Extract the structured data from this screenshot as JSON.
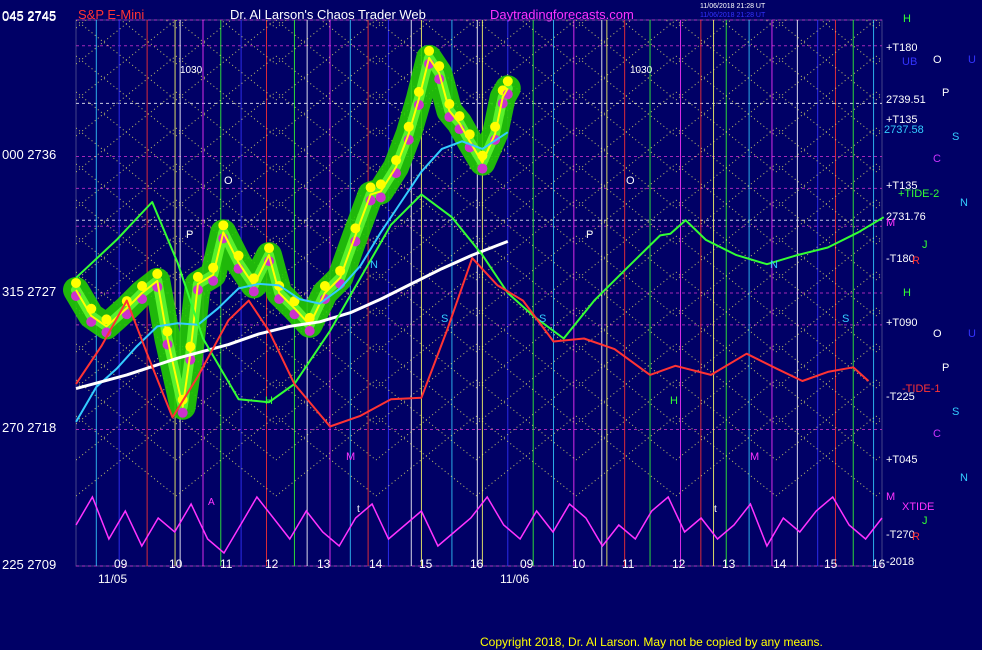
{
  "header": {
    "instrument": "S&P E-Mini",
    "title": "Dr. Al Larson's Chaos Trader Web",
    "site": "Daytradingforecasts.com",
    "timestamp_1": "11/06/2018 21:28 UT",
    "timestamp_2": "11/06/2018 21:28 UT",
    "software": "",
    "top_left_price": "045 2745"
  },
  "footer": {
    "copyright": "Copyright 2018, Dr. Al Larson. May not be copied by any means."
  },
  "axis": {
    "left_labels": [
      {
        "text": "045  2745",
        "value": 2745
      },
      {
        "text": "000  2736",
        "value": 2736
      },
      {
        "text": "315  2727",
        "value": 2727
      },
      {
        "text": "270  2718",
        "value": 2718
      },
      {
        "text": "225  2709",
        "value": 2709
      }
    ],
    "hours": [
      "09",
      "10",
      "11",
      "12",
      "13",
      "14",
      "15",
      "16",
      "09",
      "10",
      "11",
      "12",
      "13",
      "14",
      "15",
      "16"
    ],
    "dates": [
      "11/05",
      "11/06"
    ],
    "ylim": [
      2709,
      2745
    ]
  },
  "right_labels": [
    {
      "text": "+T180",
      "color": "#ffffff"
    },
    {
      "text": "UB",
      "color": "#3333ff"
    },
    {
      "text": "O",
      "color": "#ffffff"
    },
    {
      "text": "U",
      "color": "#3333ff"
    },
    {
      "text": "2739.51",
      "color": "#ffffff"
    },
    {
      "text": "P",
      "color": "#ffffff"
    },
    {
      "text": "+T135",
      "color": "#ffffff"
    },
    {
      "text": "2737.58",
      "color": "#33ccff"
    },
    {
      "text": "S",
      "color": "#33ccff"
    },
    {
      "text": "C",
      "color": "#cc33ff"
    },
    {
      "text": "+T135",
      "color": "#ffffff"
    },
    {
      "text": "+TIDE-2",
      "color": "#33ff33"
    },
    {
      "text": "N",
      "color": "#33ccff"
    },
    {
      "text": "2731.76",
      "color": "#ffffff"
    },
    {
      "text": "M",
      "color": "#ff33ff"
    },
    {
      "text": "J",
      "color": "#33ff33"
    },
    {
      "text": "-T180",
      "color": "#ffffff"
    },
    {
      "text": "R",
      "color": "#ff3333"
    },
    {
      "text": "H",
      "color": "#33ff33"
    },
    {
      "text": "+T090",
      "color": "#ffffff"
    },
    {
      "text": "O",
      "color": "#ffffff"
    },
    {
      "text": "U",
      "color": "#3333ff"
    },
    {
      "text": "P",
      "color": "#ffffff"
    },
    {
      "text": "-TIDE-1",
      "color": "#ff3333"
    },
    {
      "text": "-T225",
      "color": "#ffffff"
    },
    {
      "text": "S",
      "color": "#33ccff"
    },
    {
      "text": "C",
      "color": "#cc33ff"
    },
    {
      "text": "+T045",
      "color": "#ffffff"
    },
    {
      "text": "N",
      "color": "#33ccff"
    },
    {
      "text": "M",
      "color": "#ff33ff"
    },
    {
      "text": "XTIDE",
      "color": "#ff33ff"
    },
    {
      "text": "J",
      "color": "#33ff33"
    },
    {
      "text": "-T270",
      "color": "#ffffff"
    },
    {
      "text": "R",
      "color": "#ff3333"
    },
    {
      "text": "-2018",
      "color": "#ffffff"
    },
    {
      "text": "H",
      "color": "#33ff33"
    }
  ],
  "chart_labels": [
    {
      "text": "1030",
      "color": "#ffffff"
    },
    {
      "text": "O",
      "color": "#ffffff"
    },
    {
      "text": "P",
      "color": "#ffffff"
    },
    {
      "text": "H",
      "color": "#33ff33"
    },
    {
      "text": "N",
      "color": "#33ccff"
    },
    {
      "text": "S",
      "color": "#33ccff"
    },
    {
      "text": "M",
      "color": "#ff33ff"
    },
    {
      "text": "t",
      "color": "#ffffff"
    },
    {
      "text": "1030",
      "color": "#ffffff"
    },
    {
      "text": "O",
      "color": "#ffffff"
    },
    {
      "text": "P",
      "color": "#ffffff"
    },
    {
      "text": "S",
      "color": "#33ccff"
    },
    {
      "text": "H",
      "color": "#33ff33"
    },
    {
      "text": "N",
      "color": "#33ccff"
    },
    {
      "text": "S",
      "color": "#33ccff"
    },
    {
      "text": "M",
      "color": "#ff33ff"
    },
    {
      "text": "t",
      "color": "#ffffff"
    },
    {
      "text": "A",
      "color": "#ff33ff"
    }
  ],
  "chart_data": {
    "type": "line",
    "title": "S&P E-Mini",
    "ylim": [
      2709,
      2745
    ],
    "x_unit": "trading hour index (0 = 11/05 09:00)",
    "series": [
      {
        "name": "",
        "color": "#ffff00",
        "points": [
          [
            0,
            2727.2
          ],
          [
            0.3,
            2725.5
          ],
          [
            0.6,
            2724.8
          ],
          [
            1.0,
            2726.0
          ],
          [
            1.3,
            2727.0
          ],
          [
            1.6,
            2727.8
          ],
          [
            1.8,
            2724.0
          ],
          [
            2.1,
            2719.5
          ],
          [
            2.25,
            2723.0
          ],
          [
            2.4,
            2727.6
          ],
          [
            2.7,
            2728.2
          ],
          [
            2.9,
            2731.0
          ],
          [
            3.2,
            2729.0
          ],
          [
            3.5,
            2727.5
          ],
          [
            3.8,
            2729.5
          ],
          [
            4.0,
            2727.0
          ],
          [
            4.3,
            2726.0
          ],
          [
            4.6,
            2724.9
          ],
          [
            4.9,
            2727.0
          ],
          [
            5.2,
            2728.0
          ],
          [
            5.5,
            2730.8
          ],
          [
            5.8,
            2733.5
          ],
          [
            6.0,
            2733.7
          ],
          [
            6.3,
            2735.3
          ],
          [
            6.55,
            2737.5
          ],
          [
            6.75,
            2739.8
          ],
          [
            6.95,
            2742.5
          ],
          [
            7.15,
            2741.5
          ],
          [
            7.35,
            2739.0
          ],
          [
            7.55,
            2738.2
          ],
          [
            7.75,
            2737.0
          ],
          [
            8.0,
            2735.6
          ],
          [
            8.25,
            2737.5
          ],
          [
            8.4,
            2739.9
          ],
          [
            8.5,
            2740.5
          ]
        ]
      },
      {
        "name": "",
        "color": "#33ccff",
        "points": [
          [
            0,
            2718.5
          ],
          [
            0.4,
            2720.8
          ],
          [
            0.8,
            2722.0
          ],
          [
            1.2,
            2723.5
          ],
          [
            1.6,
            2724.8
          ],
          [
            2.0,
            2725.0
          ],
          [
            2.4,
            2724.9
          ],
          [
            2.8,
            2726.0
          ],
          [
            3.2,
            2727.3
          ],
          [
            3.6,
            2727.6
          ],
          [
            4.0,
            2727.5
          ],
          [
            4.4,
            2726.6
          ],
          [
            4.8,
            2726.3
          ],
          [
            5.2,
            2727.3
          ],
          [
            5.6,
            2728.8
          ],
          [
            6.0,
            2731.0
          ],
          [
            6.4,
            2733.0
          ],
          [
            6.8,
            2735.0
          ],
          [
            7.2,
            2736.5
          ],
          [
            7.6,
            2737.0
          ],
          [
            8.0,
            2736.5
          ],
          [
            8.5,
            2737.6
          ]
        ]
      },
      {
        "name": "",
        "color": "#ffffff",
        "points": [
          [
            0,
            2720.7
          ],
          [
            1.0,
            2721.6
          ],
          [
            2.0,
            2722.7
          ],
          [
            3.0,
            2723.6
          ],
          [
            3.6,
            2724.3
          ],
          [
            4.2,
            2724.8
          ],
          [
            4.8,
            2725.1
          ],
          [
            5.4,
            2725.7
          ],
          [
            6.0,
            2726.6
          ],
          [
            6.6,
            2727.6
          ],
          [
            7.2,
            2728.6
          ],
          [
            7.8,
            2729.5
          ],
          [
            8.5,
            2730.4
          ]
        ]
      },
      {
        "name": "",
        "color": "#33ff33",
        "points": [
          [
            0,
            2728
          ],
          [
            0.8,
            2730.5
          ],
          [
            1.5,
            2733.0
          ],
          [
            2.0,
            2729.0
          ],
          [
            2.5,
            2724.0
          ],
          [
            3.2,
            2720.0
          ],
          [
            3.8,
            2719.8
          ],
          [
            4.3,
            2721.0
          ],
          [
            5.0,
            2724.5
          ],
          [
            5.6,
            2728.0
          ],
          [
            6.2,
            2731.5
          ],
          [
            6.8,
            2733.5
          ],
          [
            7.4,
            2732.0
          ],
          [
            8.0,
            2729.5
          ],
          [
            8.5,
            2727.0
          ],
          [
            9.0,
            2725.5
          ],
          [
            9.6,
            2724.0
          ],
          [
            10.2,
            2726.5
          ],
          [
            10.8,
            2728.5
          ],
          [
            11.5,
            2730.8
          ],
          [
            11.7,
            2730.9
          ],
          [
            12.0,
            2731.8
          ],
          [
            12.4,
            2730.5
          ],
          [
            13.0,
            2729.5
          ],
          [
            13.6,
            2728.9
          ],
          [
            14.2,
            2729.5
          ],
          [
            14.8,
            2730.0
          ],
          [
            15.4,
            2731.0
          ],
          [
            15.9,
            2732.0
          ]
        ]
      },
      {
        "name": "",
        "color": "#ff3333",
        "points": [
          [
            0,
            2721.0
          ],
          [
            0.5,
            2723.5
          ],
          [
            1.0,
            2726.5
          ],
          [
            1.4,
            2723.0
          ],
          [
            1.9,
            2718.8
          ],
          [
            2.4,
            2721.5
          ],
          [
            3.0,
            2725.2
          ],
          [
            3.4,
            2726.5
          ],
          [
            3.8,
            2724.5
          ],
          [
            4.3,
            2721.0
          ],
          [
            5.0,
            2718.2
          ],
          [
            5.6,
            2718.9
          ],
          [
            6.2,
            2720.0
          ],
          [
            6.8,
            2720.1
          ],
          [
            7.3,
            2724.5
          ],
          [
            7.8,
            2729.3
          ],
          [
            8.3,
            2727.5
          ],
          [
            8.8,
            2726.5
          ],
          [
            9.4,
            2723.8
          ],
          [
            10.0,
            2724.0
          ],
          [
            10.6,
            2723.3
          ],
          [
            11.3,
            2721.6
          ],
          [
            11.8,
            2722.2
          ],
          [
            12.5,
            2721.6
          ],
          [
            13.2,
            2723.0
          ],
          [
            13.8,
            2722.0
          ],
          [
            14.3,
            2721.2
          ],
          [
            14.8,
            2721.8
          ],
          [
            15.3,
            2722.1
          ],
          [
            15.6,
            2721.2
          ]
        ]
      }
    ],
    "xtide": {
      "name": "XTIDE",
      "color": "#ff33ff",
      "values": [
        0.5,
        0.9,
        0.3,
        0.7,
        0.2,
        0.6,
        0.4,
        0.8,
        0.3,
        0.1,
        0.5,
        0.9,
        0.6,
        0.3,
        0.7,
        0.4,
        0.2,
        0.6,
        0.8,
        0.3,
        0.5,
        0.7,
        0.2,
        0.4,
        0.6,
        0.9,
        0.5,
        0.3,
        0.7,
        0.4,
        0.8,
        0.6,
        0.2,
        0.5,
        0.3,
        0.7,
        0.9,
        0.4,
        0.6,
        0.3,
        0.5,
        0.8,
        0.2,
        0.6,
        0.4,
        0.7,
        0.9,
        0.5,
        0.3,
        0.6
      ]
    },
    "grid": true,
    "legend": "right"
  }
}
